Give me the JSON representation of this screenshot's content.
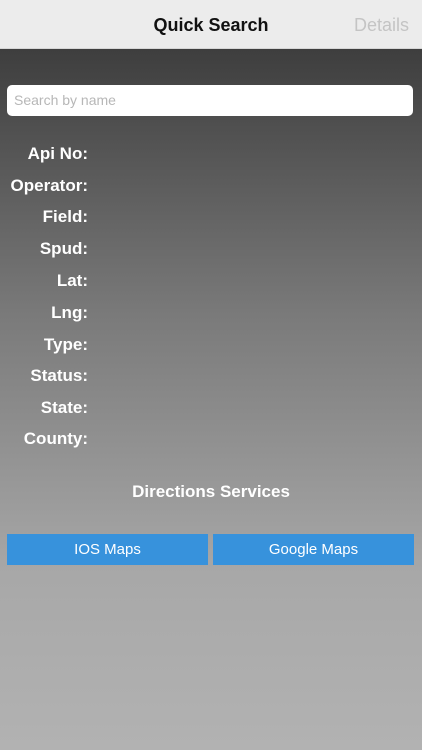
{
  "navbar": {
    "title": "Quick Search",
    "details_label": "Details"
  },
  "search": {
    "placeholder": "Search by name",
    "value": ""
  },
  "fields": [
    {
      "label": "Api No:",
      "value": ""
    },
    {
      "label": "Operator:",
      "value": ""
    },
    {
      "label": "Field:",
      "value": ""
    },
    {
      "label": "Spud:",
      "value": ""
    },
    {
      "label": "Lat:",
      "value": ""
    },
    {
      "label": "Lng:",
      "value": ""
    },
    {
      "label": "Type:",
      "value": ""
    },
    {
      "label": "Status:",
      "value": ""
    },
    {
      "label": "State:",
      "value": ""
    },
    {
      "label": "County:",
      "value": ""
    }
  ],
  "directions": {
    "title": "Directions Services",
    "ios_maps_label": "IOS Maps",
    "google_maps_label": "Google Maps"
  },
  "colors": {
    "button": "#3792dc",
    "navbar": "#ececec",
    "details_inactive": "#c4c4c4"
  }
}
